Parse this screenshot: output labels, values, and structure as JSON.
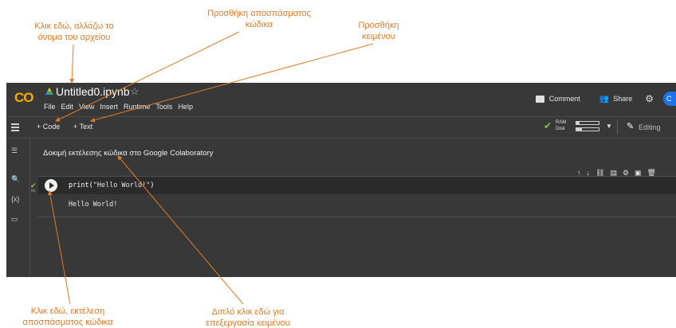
{
  "annotations": {
    "rename": [
      "Κλικ εδώ, αλλάζω το",
      "όνομα του αρχείου"
    ],
    "add_code": [
      "Προσθήκη αποσπάσματος",
      "κώδικα"
    ],
    "add_text": [
      "Προσθήκη",
      "κειμένου"
    ],
    "run": [
      "Κλικ εδώ, εκτέλεση",
      "αποσπάσματος κώδικα"
    ],
    "edit_text": [
      "Διπλό κλικ εδώ για",
      "επεξεργασία κειμένου"
    ],
    "color": "#e07b27"
  },
  "app": {
    "logo": "CO",
    "file_title": "Untitled0.ipynb",
    "star": "☆",
    "menu": [
      "File",
      "Edit",
      "View",
      "Insert",
      "Runtime",
      "Tools",
      "Help"
    ],
    "comment_label": "Comment",
    "share_label": "Share",
    "avatar_initial": "C"
  },
  "toolbar": {
    "add_code_label": "+ Code",
    "add_text_label": "+ Text",
    "ram_label": "RAM",
    "disk_label": "Disk",
    "ram_usage": 0.15,
    "disk_usage": 0.25,
    "editing_label": "Editing"
  },
  "sidebar": {
    "icons": [
      "menu-icon",
      "search-icon",
      "variables-icon",
      "folder-icon"
    ],
    "variables_label": "{x}"
  },
  "notebook": {
    "text_cell": "Δοκιμή εκτέλεσης κώδικα στο Google Colaboratory",
    "code_fn": "print(",
    "code_str": "\"Hello World!\"",
    "code_end": ")",
    "exec_count": "0s",
    "output": "Hello World!"
  }
}
